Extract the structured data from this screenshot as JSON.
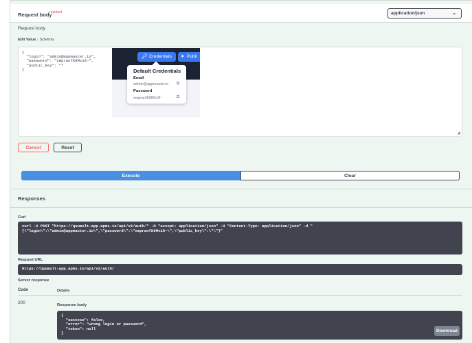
{
  "request_body": {
    "title": "Request body",
    "required_label": "required",
    "content_type": "application/json",
    "sub_label": "Request body",
    "tab_edit": "Edit Value",
    "tab_separator": "|",
    "tab_schema": "Schema",
    "editor_value": "{\n  \"login\": \"admin@appmaster.io\",\n  \"password\": \"xmpranfK8Mv18~\",\n  \"public_key\": \"\"\n}",
    "embedded_screenshot": {
      "credentials_button": "Credentials",
      "public_button": "Publi",
      "popover_title": "Default Credentials",
      "email_label": "Email",
      "email_value": "admin@appmaster.io",
      "password_label": "Password",
      "password_value": "xmpranfK8Mv18~"
    },
    "cancel_label": "Cancel",
    "reset_label": "Reset"
  },
  "actions": {
    "execute_label": "Execute",
    "clear_label": "Clear"
  },
  "responses": {
    "title": "Responses",
    "curl_label": "Curl",
    "curl_value": "curl -X POST \"https://quumult-app.apms.io/api/v2/auth/\" -H \"accept: application/json\" -H \"Content-Type: application/json\" -d \"\n{\\\"login\\\":\\\"admin@appmaster.io\\\",\\\"password\\\":\\\"xmpranfK8Mv18~\\\",\\\"public_key\\\":\\\"\\\"}\"",
    "request_url_label": "Request URL",
    "request_url_value": "https://quumult-app.apms.io/api/v2/auth/",
    "server_response_label": "Server response",
    "col_code": "Code",
    "col_details": "Details",
    "status_code": "200",
    "response_body_label": "Response body",
    "response_body_value": "{\n  \"success\": false,\n  \"error\": \"wrong login or password\",\n  \"token\": null\n}",
    "download_label": "Download"
  },
  "colors": {
    "execute": "#4990e2",
    "cancel": "#ff6060",
    "required": "#f93e3e",
    "code_bg": "#41444e",
    "section_bg": "#edf6f0"
  }
}
